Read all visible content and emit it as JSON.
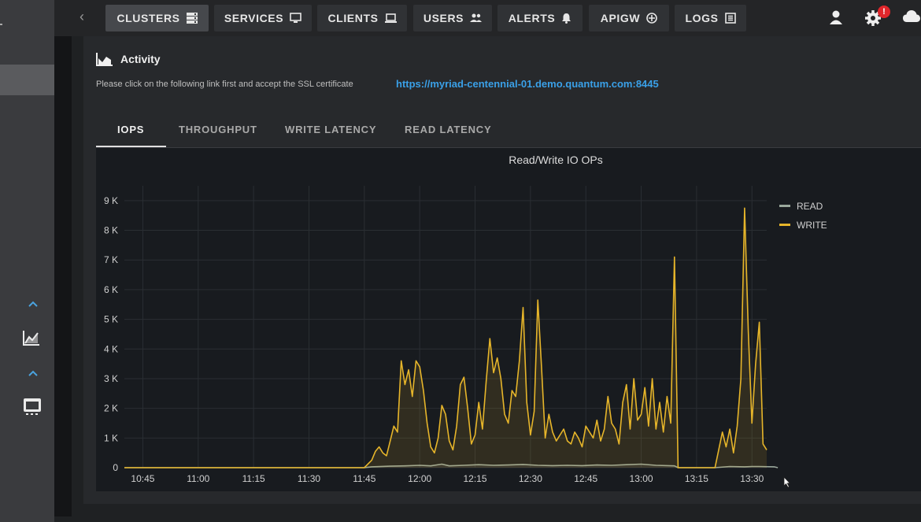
{
  "nav": {
    "back_label": "‹",
    "tabs": [
      {
        "label": "CLUSTERS",
        "icon": "server-icon",
        "active": true
      },
      {
        "label": "SERVICES",
        "icon": "monitor-icon",
        "active": false
      },
      {
        "label": "CLIENTS",
        "icon": "laptop-icon",
        "active": false
      },
      {
        "label": "USERS",
        "icon": "users-icon",
        "active": false
      },
      {
        "label": "ALERTS",
        "icon": "bell-icon",
        "active": false
      },
      {
        "label": "APIGW",
        "icon": "plus-circle-icon",
        "active": false
      },
      {
        "label": "LOGS",
        "icon": "document-icon",
        "active": false
      }
    ],
    "notification_badge": "!"
  },
  "activity": {
    "title": "Activity",
    "ssl_note": "Please click on the following link first and accept the SSL certificate",
    "ssl_link": "https://myriad-centennial-01.demo.quantum.com:8445",
    "tabs": [
      "IOPS",
      "THROUGHPUT",
      "WRITE LATENCY",
      "READ LATENCY"
    ],
    "active_tab": "IOPS"
  },
  "colors": {
    "accent": "#3aa0e8",
    "read": "#9aa89c",
    "write": "#e6b52a",
    "badge": "#e0262b"
  },
  "chart_data": {
    "type": "line",
    "title": "Read/Write IO OPs",
    "yticks": [
      "0",
      "1 K",
      "2 K",
      "3 K",
      "4 K",
      "5 K",
      "6 K",
      "7 K",
      "8 K",
      "9 K"
    ],
    "xticks": [
      "10:45",
      "11:00",
      "11:15",
      "11:30",
      "11:45",
      "12:00",
      "12:15",
      "12:30",
      "12:45",
      "13:00",
      "13:15",
      "13:30"
    ],
    "ylim": [
      0,
      9500
    ],
    "grid": true,
    "legend_position": "right",
    "series": [
      {
        "name": "READ",
        "color": "#9aa89c",
        "points": [
          [
            "10:40",
            0
          ],
          [
            "11:45",
            0
          ],
          [
            "11:47",
            30
          ],
          [
            "11:52",
            50
          ],
          [
            "11:56",
            60
          ],
          [
            "12:00",
            80
          ],
          [
            "12:03",
            60
          ],
          [
            "12:06",
            120
          ],
          [
            "12:08",
            60
          ],
          [
            "12:12",
            80
          ],
          [
            "12:16",
            100
          ],
          [
            "12:20",
            80
          ],
          [
            "12:24",
            90
          ],
          [
            "12:28",
            110
          ],
          [
            "12:32",
            80
          ],
          [
            "12:36",
            70
          ],
          [
            "12:40",
            80
          ],
          [
            "12:44",
            70
          ],
          [
            "12:48",
            90
          ],
          [
            "12:52",
            80
          ],
          [
            "12:56",
            100
          ],
          [
            "13:00",
            120
          ],
          [
            "13:04",
            80
          ],
          [
            "13:09",
            60
          ],
          [
            "13:10",
            0
          ],
          [
            "13:20",
            0
          ],
          [
            "13:24",
            40
          ],
          [
            "13:28",
            30
          ],
          [
            "13:30",
            40
          ],
          [
            "13:32",
            40
          ],
          [
            "13:36",
            30
          ],
          [
            "13:37",
            0
          ]
        ]
      },
      {
        "name": "WRITE",
        "color": "#e6b52a",
        "points": [
          [
            "10:40",
            0
          ],
          [
            "11:45",
            0
          ],
          [
            "11:47",
            250
          ],
          [
            "11:48",
            550
          ],
          [
            "11:49",
            700
          ],
          [
            "11:50",
            500
          ],
          [
            "11:51",
            400
          ],
          [
            "11:52",
            900
          ],
          [
            "11:53",
            1400
          ],
          [
            "11:54",
            1200
          ],
          [
            "11:55",
            3600
          ],
          [
            "11:56",
            2800
          ],
          [
            "11:57",
            3300
          ],
          [
            "11:58",
            2400
          ],
          [
            "11:59",
            3600
          ],
          [
            "12:00",
            3400
          ],
          [
            "12:01",
            2600
          ],
          [
            "12:02",
            1500
          ],
          [
            "12:03",
            700
          ],
          [
            "12:04",
            500
          ],
          [
            "12:05",
            1000
          ],
          [
            "12:06",
            2100
          ],
          [
            "12:07",
            1800
          ],
          [
            "12:08",
            900
          ],
          [
            "12:09",
            600
          ],
          [
            "12:10",
            1400
          ],
          [
            "12:11",
            2800
          ],
          [
            "12:12",
            3050
          ],
          [
            "12:13",
            2000
          ],
          [
            "12:14",
            800
          ],
          [
            "12:15",
            1100
          ],
          [
            "12:16",
            2200
          ],
          [
            "12:17",
            1300
          ],
          [
            "12:18",
            2900
          ],
          [
            "12:19",
            4350
          ],
          [
            "12:20",
            3200
          ],
          [
            "12:21",
            3700
          ],
          [
            "12:22",
            3000
          ],
          [
            "12:23",
            1800
          ],
          [
            "12:24",
            1500
          ],
          [
            "12:25",
            2600
          ],
          [
            "12:26",
            2400
          ],
          [
            "12:27",
            3600
          ],
          [
            "12:28",
            5400
          ],
          [
            "12:29",
            2200
          ],
          [
            "12:30",
            1100
          ],
          [
            "12:31",
            1900
          ],
          [
            "12:32",
            5650
          ],
          [
            "12:33",
            3400
          ],
          [
            "12:34",
            1000
          ],
          [
            "12:35",
            1800
          ],
          [
            "12:36",
            1200
          ],
          [
            "12:37",
            900
          ],
          [
            "12:38",
            1100
          ],
          [
            "12:39",
            1300
          ],
          [
            "12:40",
            900
          ],
          [
            "12:41",
            800
          ],
          [
            "12:42",
            1200
          ],
          [
            "12:43",
            1000
          ],
          [
            "12:44",
            700
          ],
          [
            "12:45",
            1400
          ],
          [
            "12:46",
            1200
          ],
          [
            "12:47",
            1000
          ],
          [
            "12:48",
            1600
          ],
          [
            "12:49",
            900
          ],
          [
            "12:50",
            1300
          ],
          [
            "12:51",
            2400
          ],
          [
            "12:52",
            1500
          ],
          [
            "12:53",
            1300
          ],
          [
            "12:54",
            800
          ],
          [
            "12:55",
            2200
          ],
          [
            "12:56",
            2800
          ],
          [
            "12:57",
            1300
          ],
          [
            "12:58",
            3000
          ],
          [
            "12:59",
            1600
          ],
          [
            "13:00",
            1800
          ],
          [
            "13:01",
            2700
          ],
          [
            "13:02",
            1400
          ],
          [
            "13:03",
            3000
          ],
          [
            "13:04",
            1300
          ],
          [
            "13:05",
            2200
          ],
          [
            "13:06",
            1200
          ],
          [
            "13:07",
            2400
          ],
          [
            "13:08",
            1500
          ],
          [
            "13:09",
            7100
          ],
          [
            "13:10",
            0
          ],
          [
            "13:20",
            0
          ],
          [
            "13:21",
            600
          ],
          [
            "13:22",
            1200
          ],
          [
            "13:23",
            700
          ],
          [
            "13:24",
            1300
          ],
          [
            "13:25",
            500
          ],
          [
            "13:26",
            1400
          ],
          [
            "13:27",
            3000
          ],
          [
            "13:28",
            8750
          ],
          [
            "13:29",
            4600
          ],
          [
            "13:30",
            1500
          ],
          [
            "13:31",
            3500
          ],
          [
            "13:32",
            4900
          ],
          [
            "13:33",
            800
          ],
          [
            "13:34",
            600
          ]
        ]
      }
    ]
  }
}
